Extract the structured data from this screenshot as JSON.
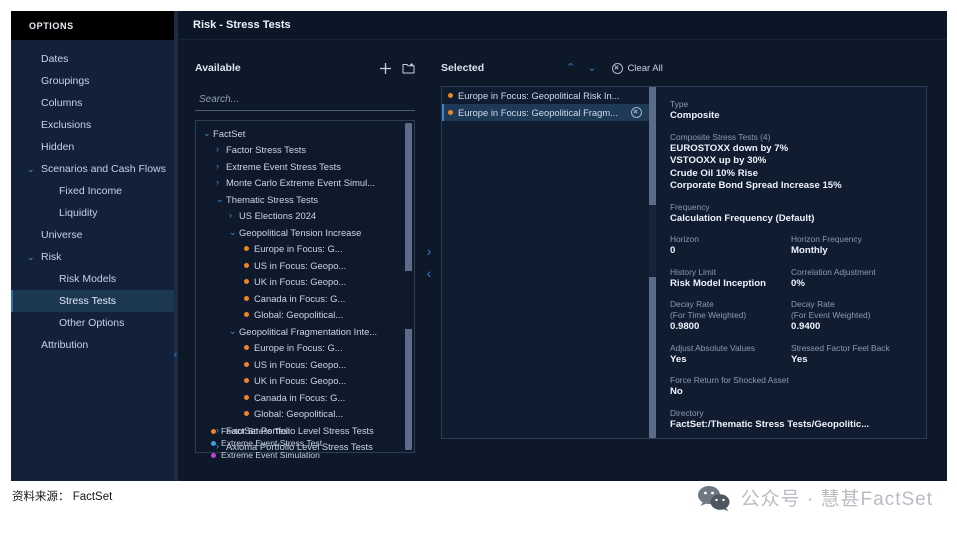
{
  "app": {
    "title": "Risk - Stress Tests"
  },
  "sidebar": {
    "header": "OPTIONS",
    "items": [
      {
        "label": "Dates",
        "level": 0,
        "chevron": "",
        "active": false
      },
      {
        "label": "Groupings",
        "level": 0,
        "chevron": "",
        "active": false
      },
      {
        "label": "Columns",
        "level": 0,
        "chevron": "",
        "active": false
      },
      {
        "label": "Exclusions",
        "level": 0,
        "chevron": "",
        "active": false
      },
      {
        "label": "Hidden",
        "level": 0,
        "chevron": "",
        "active": false
      },
      {
        "label": "Scenarios and Cash Flows",
        "level": 0,
        "chevron": "⌄",
        "active": false
      },
      {
        "label": "Fixed Income",
        "level": 1,
        "chevron": "",
        "active": false
      },
      {
        "label": "Liquidity",
        "level": 1,
        "chevron": "",
        "active": false
      },
      {
        "label": "Universe",
        "level": 0,
        "chevron": "",
        "active": false
      },
      {
        "label": "Risk",
        "level": 0,
        "chevron": "⌄",
        "active": false
      },
      {
        "label": "Risk Models",
        "level": 1,
        "chevron": "",
        "active": false
      },
      {
        "label": "Stress Tests",
        "level": 1,
        "chevron": "",
        "active": true
      },
      {
        "label": "Other Options",
        "level": 1,
        "chevron": "",
        "active": false
      },
      {
        "label": "Attribution",
        "level": 0,
        "chevron": "",
        "active": false
      }
    ]
  },
  "available": {
    "title": "Available",
    "add_icon": "plus-icon",
    "new_folder_icon": "new-folder-icon",
    "search": {
      "placeholder": "Search...",
      "value": ""
    },
    "tree": [
      {
        "label": "FactSet",
        "indent": 0,
        "chevron": "⌄",
        "dot": ""
      },
      {
        "label": "Factor Stress Tests",
        "indent": 1,
        "chevron": "›",
        "dot": ""
      },
      {
        "label": "Extreme Event Stress Tests",
        "indent": 1,
        "chevron": "›",
        "dot": ""
      },
      {
        "label": "Monte Carlo Extreme Event Simul...",
        "indent": 1,
        "chevron": "›",
        "dot": ""
      },
      {
        "label": "Thematic Stress Tests",
        "indent": 1,
        "chevron": "⌄",
        "dot": ""
      },
      {
        "label": "US Elections 2024",
        "indent": 2,
        "chevron": "›",
        "dot": ""
      },
      {
        "label": "Geopolitical Tension Increase",
        "indent": 2,
        "chevron": "⌄",
        "dot": ""
      },
      {
        "label": "Europe in Focus: G...",
        "indent": 3,
        "chevron": "",
        "dot": "#f08322"
      },
      {
        "label": "US in Focus: Geopo...",
        "indent": 3,
        "chevron": "",
        "dot": "#f08322"
      },
      {
        "label": "UK in Focus: Geopo...",
        "indent": 3,
        "chevron": "",
        "dot": "#f08322"
      },
      {
        "label": "Canada in Focus: G...",
        "indent": 3,
        "chevron": "",
        "dot": "#f08322"
      },
      {
        "label": "Global: Geopolitical...",
        "indent": 3,
        "chevron": "",
        "dot": "#f08322"
      },
      {
        "label": "Geopolitical Fragmentation Inte...",
        "indent": 2,
        "chevron": "⌄",
        "dot": ""
      },
      {
        "label": "Europe in Focus: G...",
        "indent": 3,
        "chevron": "",
        "dot": "#f08322"
      },
      {
        "label": "US in Focus: Geopo...",
        "indent": 3,
        "chevron": "",
        "dot": "#f08322"
      },
      {
        "label": "UK in Focus: Geopo...",
        "indent": 3,
        "chevron": "",
        "dot": "#f08322"
      },
      {
        "label": "Canada in Focus: G...",
        "indent": 3,
        "chevron": "",
        "dot": "#f08322"
      },
      {
        "label": "Global: Geopolitical...",
        "indent": 3,
        "chevron": "",
        "dot": "#f08322"
      },
      {
        "label": "FactSet Portfolio Level Stress Tests",
        "indent": 1,
        "chevron": "›",
        "dot": ""
      },
      {
        "label": "Axioma Portfolio Level Stress Tests",
        "indent": 1,
        "chevron": "›",
        "dot": ""
      }
    ],
    "legend": [
      {
        "label": "Factor Stress Test",
        "color": "#f08322"
      },
      {
        "label": "Extreme Event Stress Test",
        "color": "#3aa0e0"
      },
      {
        "label": "Extreme Event Simulation",
        "color": "#c341d8"
      }
    ]
  },
  "transfer": {
    "add_label": "›",
    "remove_label": "‹"
  },
  "selected": {
    "title": "Selected",
    "move_up": "⌃",
    "move_down": "⌄",
    "clear_all": "Clear All",
    "items": [
      {
        "label": "Europe in Focus: Geopolitical Risk In...",
        "dot": "#f08322",
        "active": false
      },
      {
        "label": "Europe in Focus: Geopolitical Fragm...",
        "dot": "#f08322",
        "active": true
      }
    ]
  },
  "details": {
    "type_label": "Type",
    "type_value": "Composite",
    "composite_label": "Composite Stress Tests (4)",
    "composite_values": [
      "EUROSTOXX down by 7%",
      "VSTOOXX up by 30%",
      "Crude Oil 10% Rise",
      "Corporate Bond Spread Increase 15%"
    ],
    "frequency_label": "Frequency",
    "frequency_value": "Calculation Frequency (Default)",
    "horizon_label": "Horizon",
    "horizon_value": "0",
    "horizon_freq_label": "Horizon Frequency",
    "horizon_freq_value": "Monthly",
    "history_limit_label": "History Limit",
    "history_limit_value": "Risk Model Inception",
    "correlation_label": "Correlation Adjustment",
    "correlation_value": "0%",
    "decay_time_label1": "Decay Rate",
    "decay_time_label2": "(For Time Weighted)",
    "decay_time_value": "0.9800",
    "decay_event_label1": "Decay Rate",
    "decay_event_label2": "(For Event Weighted)",
    "decay_event_value": "0.9400",
    "adjust_abs_label": "Adjust Absolute Values",
    "adjust_abs_value": "Yes",
    "stressed_feel_label": "Stressed Factor Feel Back",
    "stressed_feel_value": "Yes",
    "force_return_label": "Force Return for Shocked Asset",
    "force_return_value": "No",
    "directory_label": "Directory",
    "directory_value": "FactSet:/Thematic Stress Tests/Geopolitic..."
  },
  "captions": {
    "source": "资料来源： FactSet",
    "watermark": "公众号 · 慧甚FactSet"
  },
  "colors": {
    "accent_blue": "#2f7fd4",
    "orange": "#f08322",
    "panel_bg": "#101c30",
    "sidebar_bg": "#12203a"
  }
}
